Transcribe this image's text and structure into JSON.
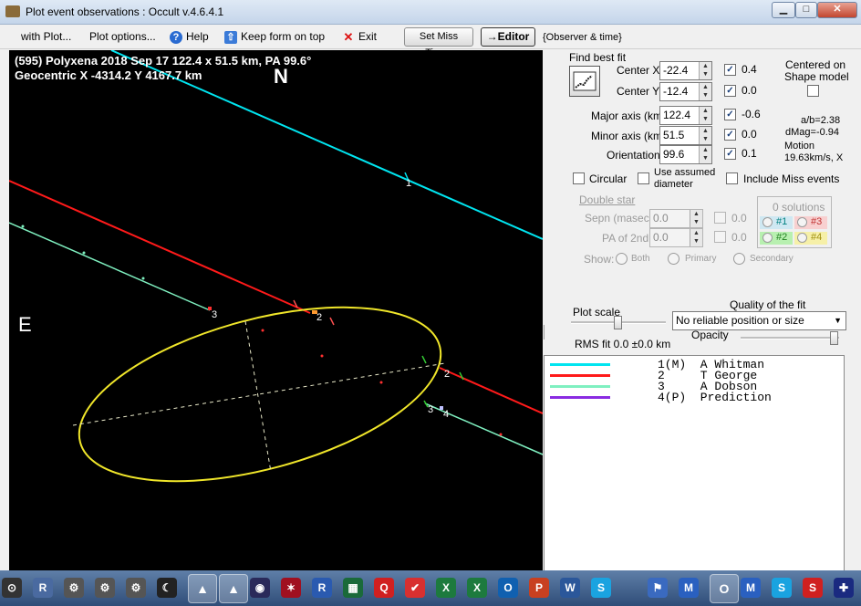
{
  "window": {
    "title": "Plot event observations : Occult v.4.6.4.1",
    "btn_min": "▁",
    "btn_max": "□",
    "btn_close": "✕"
  },
  "menu": {
    "with_plot": "with Plot...",
    "plot_options": "Plot options...",
    "help": "Help",
    "keep_on_top": "Keep form on top",
    "exit": "Exit",
    "set_miss_times": "Set Miss Times",
    "editor": "→Editor",
    "observer_time": "{Observer & time}"
  },
  "plot": {
    "header_line1": "(595) Polyxena  2018 Sep 17  122.4 x 51.5 km, PA 99.6°",
    "header_line2": "Geocentric  X  -4314.2  Y 4167.7 km",
    "north": "N",
    "east": "E",
    "chord_labels": [
      {
        "text": "1",
        "color": "#ffffff"
      },
      {
        "text": "3",
        "color": "#ffffff"
      },
      {
        "text": "2",
        "color": "#ffffff"
      },
      {
        "text": "2",
        "color": "#ffffff"
      },
      {
        "text": "3",
        "color": "#ffffff"
      },
      {
        "text": "4",
        "color": "#ffffff"
      }
    ],
    "colors": {
      "whitman": "#00e5f0",
      "george": "#ff1a1a",
      "dobson": "#7ff0c0",
      "ellipse": "#f0e62a"
    }
  },
  "panel": {
    "find_best_fit": "Find best fit",
    "center_x_label": "Center X",
    "center_x_value": "-22.4",
    "center_x_delta": "0.4",
    "center_y_label": "Center Y",
    "center_y_value": "-12.4",
    "center_y_delta": "0.0",
    "centered_on_shape_1": "Centered on",
    "centered_on_shape_2": "Shape model",
    "major_label": "Major axis (km)",
    "major_value": "122.4",
    "major_delta": "-0.6",
    "minor_label": "Minor axis (km)",
    "minor_value": "51.5",
    "minor_delta": "0.0",
    "orient_label": "Orientation",
    "orient_value": "99.6",
    "orient_delta": "0.1",
    "ab_ratio": "a/b=2.38",
    "dmag": "dMag=-0.94",
    "motion_label": "Motion",
    "motion_value": "19.63km/s, X",
    "check_mark": "✓",
    "circular": "Circular",
    "use_assumed_1": "Use assumed",
    "use_assumed_2": "diameter",
    "include_miss": "Include Miss events",
    "double_star": "Double star",
    "sepn_label": "Sepn (masec)",
    "sepn_value": "0.0",
    "sepn_delta": "0.0",
    "pa2_label": "PA of 2nd",
    "pa2_value": "0.0",
    "pa2_delta": "0.0",
    "show_label": "Show:",
    "show_both": "Both",
    "show_primary": "Primary",
    "show_secondary": "Secondary",
    "solutions_title": "0 solutions",
    "sol1": "#1",
    "sol2": "#2",
    "sol3": "#3",
    "sol4": "#4",
    "plot_scale": "Plot scale",
    "quality_label": "Quality of the fit",
    "quality_value": "No reliable position or size",
    "opacity": "Opacity",
    "rms_fit": "RMS fit  0.0 ±0.0 km"
  },
  "legend": [
    {
      "text": "1(M)  A Whitman",
      "color": "#00e5f0"
    },
    {
      "text": "2     T George",
      "color": "#ff1a1a"
    },
    {
      "text": "3     A Dobson",
      "color": "#7ff0c0"
    },
    {
      "text": "4(P)  Prediction",
      "color": "#8a2be2"
    }
  ],
  "taskbar": {
    "icons": [
      {
        "name": "start-orb-icon",
        "glyph": "⊙"
      },
      {
        "name": "register-app-icon",
        "glyph": "R"
      },
      {
        "name": "gear-app-icon-1",
        "glyph": "⚙"
      },
      {
        "name": "gear-app-icon-2",
        "glyph": "⚙"
      },
      {
        "name": "gear-app-icon-3",
        "glyph": "⚙"
      },
      {
        "name": "moon-app-icon",
        "glyph": "☾"
      },
      {
        "name": "occult-app-icon-1",
        "glyph": "▲"
      },
      {
        "name": "occult-app-icon-2",
        "glyph": "▲"
      },
      {
        "name": "globe-app-icon",
        "glyph": "◉"
      },
      {
        "name": "star-app-icon",
        "glyph": "✶"
      },
      {
        "name": "r-app-icon",
        "glyph": "R"
      },
      {
        "name": "grid-app-icon",
        "glyph": "▦"
      },
      {
        "name": "q-app-icon",
        "glyph": "Q"
      },
      {
        "name": "check-app-icon",
        "glyph": "✔"
      },
      {
        "name": "excel-app-icon-1",
        "glyph": "X"
      },
      {
        "name": "excel-app-icon-2",
        "glyph": "X"
      },
      {
        "name": "outlook-app-icon",
        "glyph": "O"
      },
      {
        "name": "powerpoint-app-icon",
        "glyph": "P"
      },
      {
        "name": "word-app-icon",
        "glyph": "W"
      },
      {
        "name": "skype-app-icon-1",
        "glyph": "S"
      },
      {
        "name": "flag-app-icon",
        "glyph": "⚑"
      },
      {
        "name": "malwarebytes-app-icon",
        "glyph": "M"
      },
      {
        "name": "outlook-app-icon-2",
        "glyph": "O"
      },
      {
        "name": "malwarebytes-app-icon-2",
        "glyph": "M"
      },
      {
        "name": "skype-app-icon-2",
        "glyph": "S"
      },
      {
        "name": "s-red-app-icon",
        "glyph": "S"
      },
      {
        "name": "au-flag-icon",
        "glyph": "✚"
      }
    ]
  }
}
